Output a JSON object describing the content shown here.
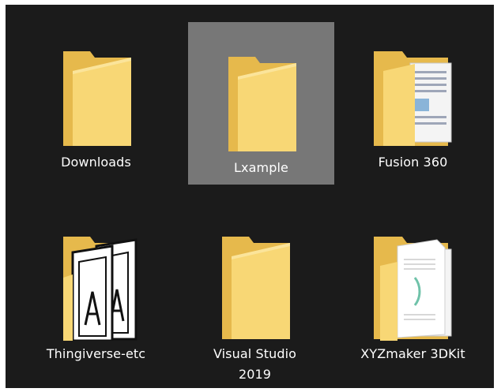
{
  "explorer": {
    "items": [
      {
        "label": "Downloads",
        "icon": "folder-icon",
        "selected": false
      },
      {
        "label": "Lxample",
        "icon": "folder-icon",
        "selected": true
      },
      {
        "label": "Fusion 360",
        "icon": "folder-with-documents-icon",
        "selected": false
      },
      {
        "label": "Thingiverse-etc",
        "icon": "folder-with-pictures-icon",
        "selected": false
      },
      {
        "label": "Visual Studio 2019",
        "icon": "folder-icon",
        "selected": false
      },
      {
        "label": "XYZmaker 3DKit",
        "icon": "folder-with-documents-icon",
        "selected": false
      }
    ]
  },
  "colors": {
    "background": "#1b1b1b",
    "selection": "#777777",
    "folder_front": "#f8d775",
    "folder_back": "#e6b94c",
    "label_text": "#ffffff"
  }
}
